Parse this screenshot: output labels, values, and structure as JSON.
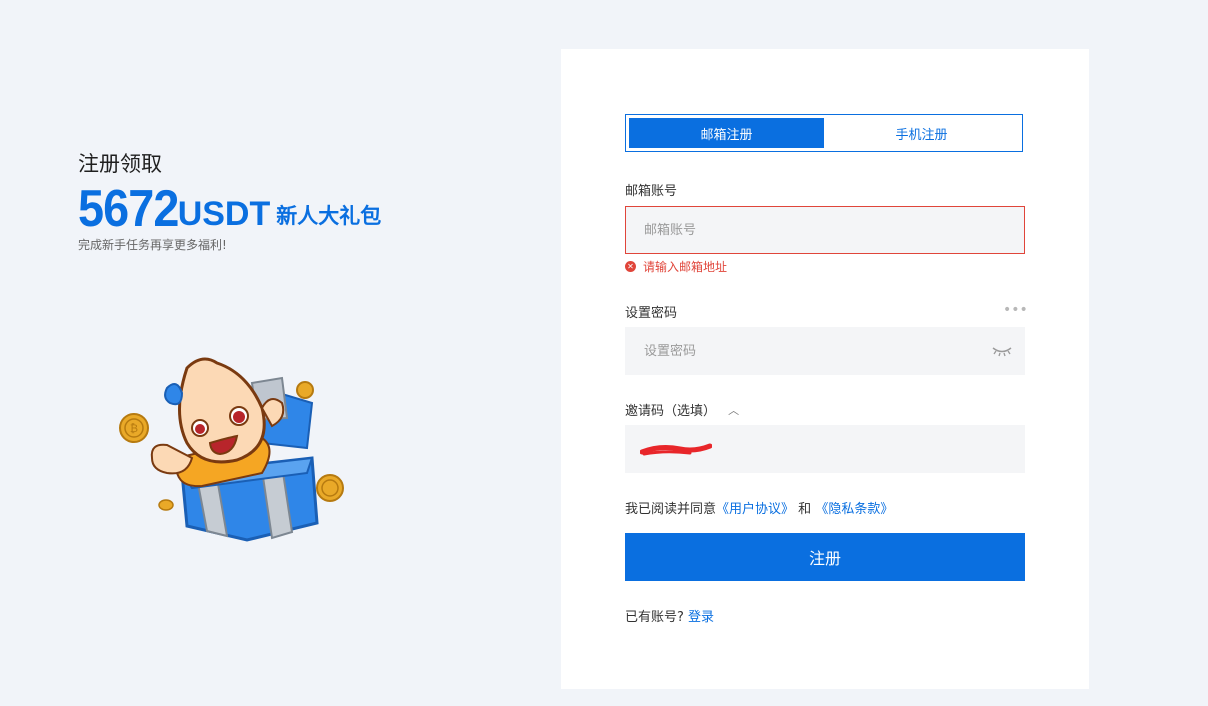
{
  "promo": {
    "title": "注册领取",
    "amount": "5672",
    "currency": "USDT",
    "gift": "新人大礼包",
    "subtitle": "完成新手任务再享更多福利!"
  },
  "tabs": [
    {
      "label": "邮箱注册",
      "active": true
    },
    {
      "label": "手机注册",
      "active": false
    }
  ],
  "email": {
    "label": "邮箱账号",
    "placeholder": "邮箱账号",
    "value": "",
    "error": "请输入邮箱地址"
  },
  "password": {
    "label": "设置密码",
    "placeholder": "设置密码",
    "value": ""
  },
  "invite": {
    "label": "邀请码（选填）"
  },
  "agreement": {
    "prefix": "我已阅读并同意",
    "user_agreement": "《用户协议》",
    "and": "和",
    "privacy": "《隐私条款》"
  },
  "submit_label": "注册",
  "login": {
    "prompt": "已有账号?",
    "link": "登录"
  },
  "colors": {
    "accent": "#0a6fe0",
    "error": "#e0453a",
    "background": "#f1f4f9"
  }
}
